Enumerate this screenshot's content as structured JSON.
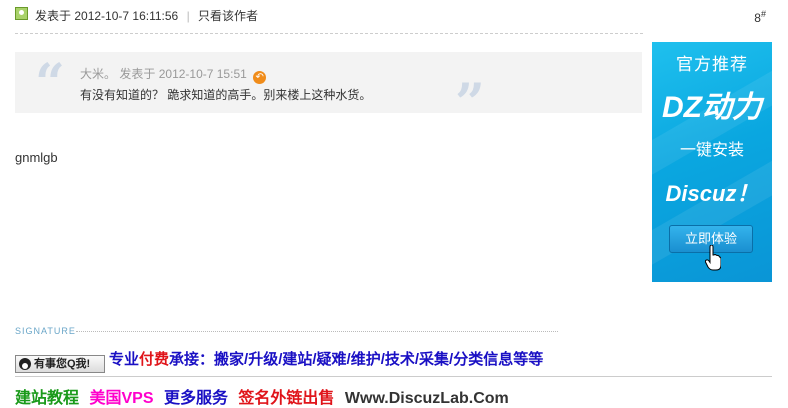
{
  "post": {
    "posted_prefix": "发表于",
    "posted_time": "2012-10-7 16:11:56",
    "author_only_label": "只看该作者",
    "floor_number": "8",
    "floor_suffix": "#"
  },
  "quote": {
    "author": "大米。",
    "posted_prefix": "发表于",
    "posted_time": "2012-10-7 15:51",
    "text": "有没有知道的？ 跪求知道的高手。别来楼上这种水货。"
  },
  "body_text": "gnmlgb",
  "ad": {
    "line1": "官方推荐",
    "line2": "DZ动力",
    "line3": "一键安装",
    "line4": "Discuz！",
    "button_label": "立即体验"
  },
  "signature": {
    "label": "SIGNATURE",
    "qq_badge": "有事您Q我!",
    "row1": {
      "seg1": "专业",
      "seg2": "付费",
      "seg3": "承接：搬家/升级/建站/疑难/维护/技术/采集/分类信息等等"
    },
    "row2": {
      "link1": "建站教程",
      "link2": "美国VPS",
      "link3": "更多服务",
      "link4": "签名外链出售",
      "link5": "Www.DiscuzLab.Com"
    }
  },
  "colors": {
    "ad_bg": "#0aa7e0",
    "blue_text": "#1a10c4",
    "red_text": "#e0141a",
    "green_text": "#1a9a1a",
    "magenta_text": "#ff00cc"
  }
}
